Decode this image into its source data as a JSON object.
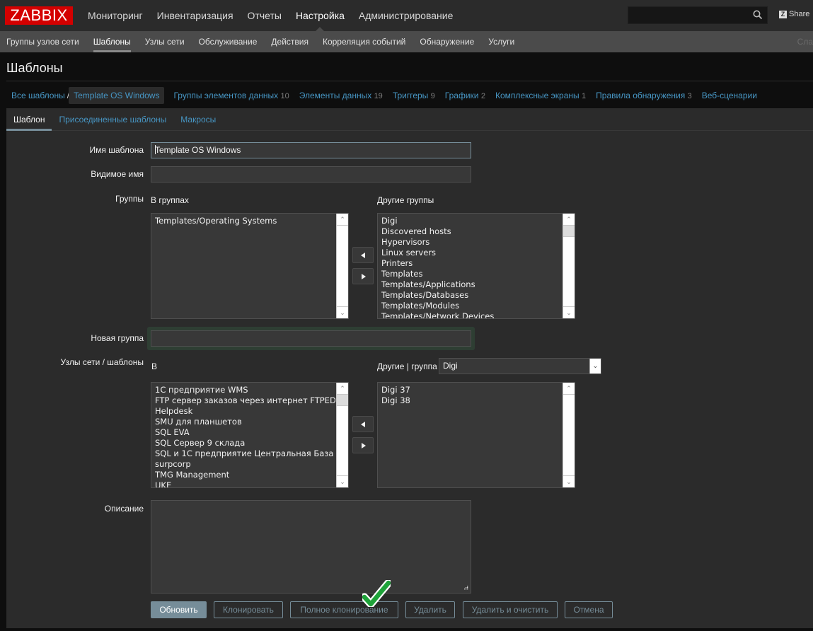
{
  "header": {
    "logo": "ZABBIX",
    "main_menu": [
      {
        "label": "Мониторинг",
        "active": false
      },
      {
        "label": "Инвентаризация",
        "active": false
      },
      {
        "label": "Отчеты",
        "active": false
      },
      {
        "label": "Настройка",
        "active": true
      },
      {
        "label": "Администрирование",
        "active": false
      }
    ],
    "search": {
      "value": "",
      "placeholder": "",
      "icon": "search-icon"
    },
    "share_label": "Share",
    "share_icon": "Z"
  },
  "sub_menu": {
    "items": [
      {
        "label": "Группы узлов сети",
        "active": false
      },
      {
        "label": "Шаблоны",
        "active": true
      },
      {
        "label": "Узлы сети",
        "active": false
      },
      {
        "label": "Обслуживание",
        "active": false
      },
      {
        "label": "Действия",
        "active": false
      },
      {
        "label": "Корреляция событий",
        "active": false
      },
      {
        "label": "Обнаружение",
        "active": false
      },
      {
        "label": "Услуги",
        "active": false
      }
    ],
    "overflow_label": "Сла"
  },
  "page": {
    "title": "Шаблоны"
  },
  "breadcrumbs": {
    "all_templates": "Все шаблоны",
    "separator": "/",
    "current": "Template OS Windows",
    "links": [
      {
        "label": "Группы элементов данных",
        "count": "10"
      },
      {
        "label": "Элементы данных",
        "count": "19"
      },
      {
        "label": "Триггеры",
        "count": "9"
      },
      {
        "label": "Графики",
        "count": "2"
      },
      {
        "label": "Комплексные экраны",
        "count": "1"
      },
      {
        "label": "Правила обнаружения",
        "count": "3"
      },
      {
        "label": "Веб-сценарии",
        "count": ""
      }
    ]
  },
  "tabs": [
    {
      "label": "Шаблон",
      "active": true
    },
    {
      "label": "Присоединенные шаблоны",
      "active": false
    },
    {
      "label": "Макросы",
      "active": false
    }
  ],
  "form": {
    "template_name": {
      "label": "Имя шаблона",
      "value": "Template OS Windows"
    },
    "visible_name": {
      "label": "Видимое имя",
      "value": ""
    },
    "groups": {
      "label": "Группы",
      "in_groups_label": "В группах",
      "other_groups_label": "Другие группы",
      "in_groups": [
        "Templates/Operating Systems"
      ],
      "other_groups": [
        "Digi",
        "Discovered hosts",
        "Hypervisors",
        "Linux servers",
        "Printers",
        "Templates",
        "Templates/Applications",
        "Templates/Databases",
        "Templates/Modules",
        "Templates/Network Devices"
      ]
    },
    "new_group": {
      "label": "Новая группа",
      "value": ""
    },
    "hosts": {
      "label": "Узлы сети / шаблоны",
      "in_label": "В",
      "other_label": "Другие | группа",
      "group_select": "Digi",
      "in_items": [
        "1С предприятие WMS",
        "FTP сервер заказов через интернет FTPEDO",
        "Helpdesk",
        "SMU для планшетов",
        "SQL EVA",
        "SQL Сервер 9 склада",
        "SQL и 1С предприятие Центральная База",
        "surpcorp",
        "TMG Management",
        "UKE"
      ],
      "other_items": [
        "Digi 37",
        "Digi 38"
      ]
    },
    "description": {
      "label": "Описание",
      "value": ""
    }
  },
  "buttons": {
    "update": "Обновить",
    "clone": "Клонировать",
    "full_clone": "Полное клонирование",
    "delete": "Удалить",
    "delete_clear": "Удалить и очистить",
    "cancel": "Отмена"
  },
  "colors": {
    "brand": "#d40000",
    "link": "#4796c4",
    "primary_button": "#768d99",
    "annotation_check": "#1fa33a"
  }
}
